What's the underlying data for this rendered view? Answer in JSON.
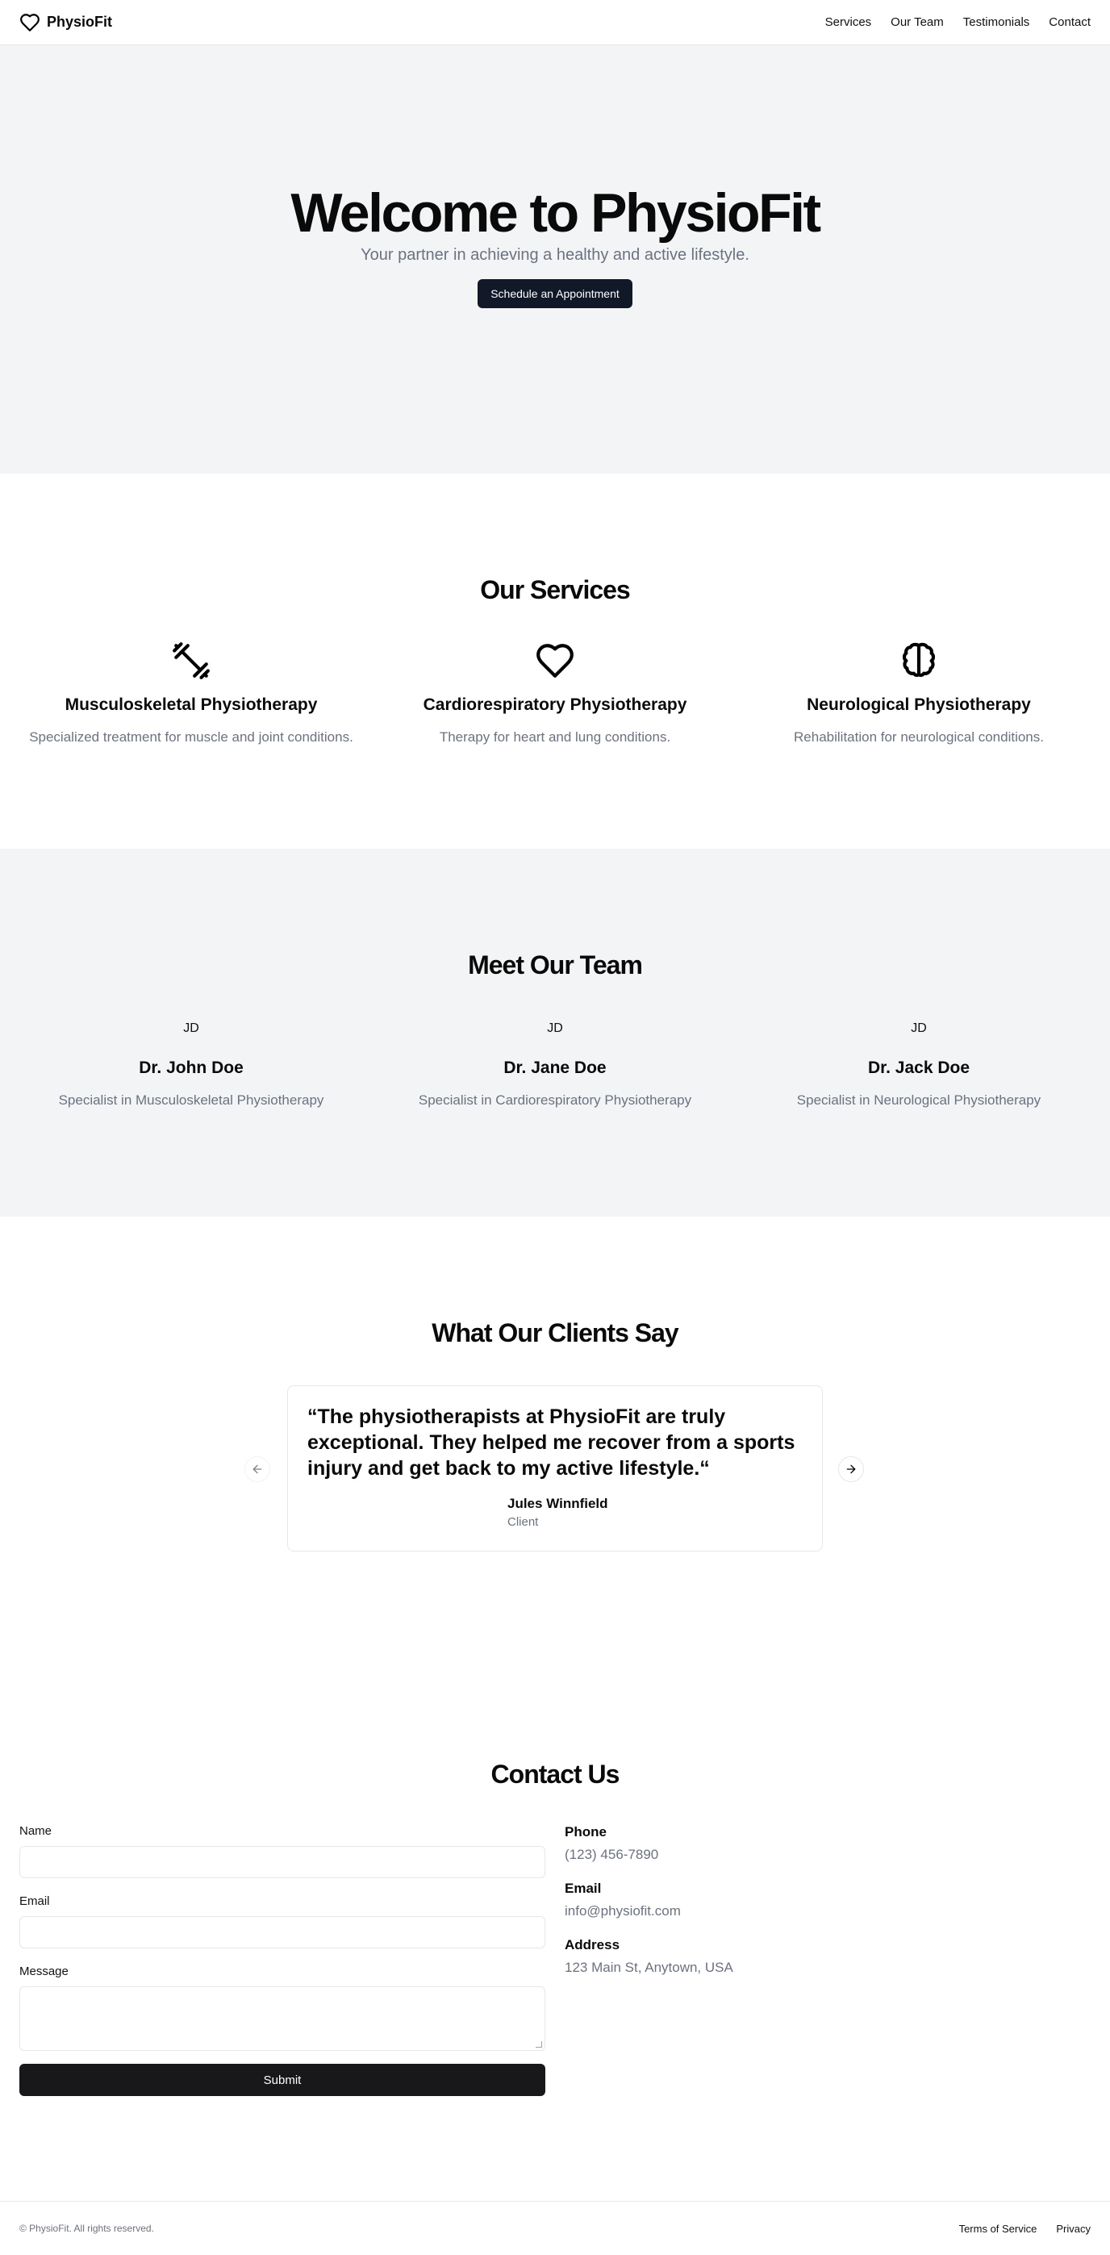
{
  "header": {
    "brand": "PhysioFit",
    "brand_icon": "heart-icon",
    "nav": [
      "Services",
      "Our Team",
      "Testimonials",
      "Contact"
    ]
  },
  "hero": {
    "title": "Welcome to PhysioFit",
    "subtitle": "Your partner in achieving a healthy and active lifestyle.",
    "cta": "Schedule an Appointment"
  },
  "services": {
    "title": "Our Services",
    "items": [
      {
        "icon": "dumbbell-icon",
        "title": "Musculoskeletal Physiotherapy",
        "desc": "Specialized treatment for muscle and joint conditions."
      },
      {
        "icon": "heart-icon",
        "title": "Cardiorespiratory Physiotherapy",
        "desc": "Therapy for heart and lung conditions."
      },
      {
        "icon": "brain-icon",
        "title": "Neurological Physiotherapy",
        "desc": "Rehabilitation for neurological conditions."
      }
    ]
  },
  "team": {
    "title": "Meet Our Team",
    "members": [
      {
        "initials": "JD",
        "name": "Dr. John Doe",
        "role": "Specialist in Musculoskeletal Physiotherapy"
      },
      {
        "initials": "JD",
        "name": "Dr. Jane Doe",
        "role": "Specialist in Cardiorespiratory Physiotherapy"
      },
      {
        "initials": "JD",
        "name": "Dr. Jack Doe",
        "role": "Specialist in Neurological Physiotherapy"
      }
    ]
  },
  "testimonials": {
    "title": "What Our Clients Say",
    "quote": "“The physiotherapists at PhysioFit are truly exceptional. They helped me recover from a sports injury and get back to my active lifestyle.“",
    "author": "Jules Winnfield",
    "author_role": "Client"
  },
  "contact": {
    "title": "Contact Us",
    "form": {
      "name_label": "Name",
      "email_label": "Email",
      "message_label": "Message",
      "submit": "Submit"
    },
    "phone_label": "Phone",
    "phone": "(123) 456-7890",
    "email_label": "Email",
    "email": "info@physiofit.com",
    "address_label": "Address",
    "address": "123 Main St, Anytown, USA"
  },
  "footer": {
    "copyright": "© PhysioFit. All rights reserved.",
    "links": [
      "Terms of Service",
      "Privacy"
    ]
  },
  "colors": {
    "accent_dark": "#111827",
    "muted_text": "#6b7280",
    "section_gray": "#f3f4f6"
  }
}
